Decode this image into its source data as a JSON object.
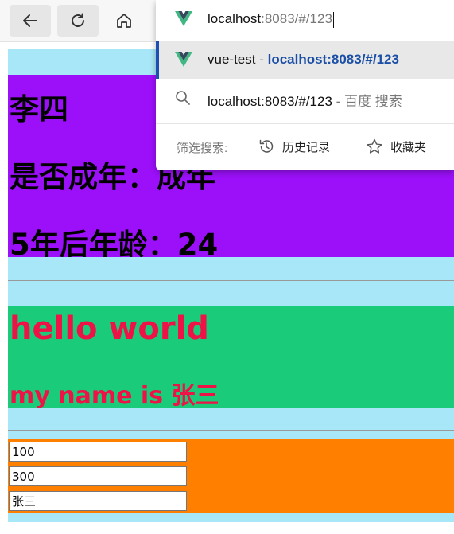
{
  "browser": {
    "icons": {
      "back": "back-arrow-icon",
      "reload": "reload-icon",
      "home": "home-icon"
    },
    "address_bar": {
      "host": "localhost",
      "rest": ":8083/#/123"
    },
    "suggestions": [
      {
        "icon": "vue-logo-icon",
        "title": "vue-test",
        "separator": " - ",
        "url": "localhost:8083/#/123",
        "selected": true
      },
      {
        "icon": "search-icon",
        "query": "localhost:8083/#/123",
        "separator": " - ",
        "engine": "百度 搜索"
      }
    ],
    "filter": {
      "label": "筛选搜索:",
      "history": "历史记录",
      "favorites": "收藏夹"
    }
  },
  "page": {
    "name": "李四",
    "adult_line": "是否成年：成年",
    "age_line": "5年后年龄：24",
    "hello": "hello world",
    "myname": "my name is 张三",
    "inputs": [
      "100",
      "300",
      "张三"
    ]
  },
  "colors": {
    "band": "#a7e7f8",
    "purple": "#9b10f8",
    "green": "#1acc7a",
    "orange": "#ff7f00",
    "red_text": "#ee1246",
    "link_blue": "#1b4fa6"
  }
}
